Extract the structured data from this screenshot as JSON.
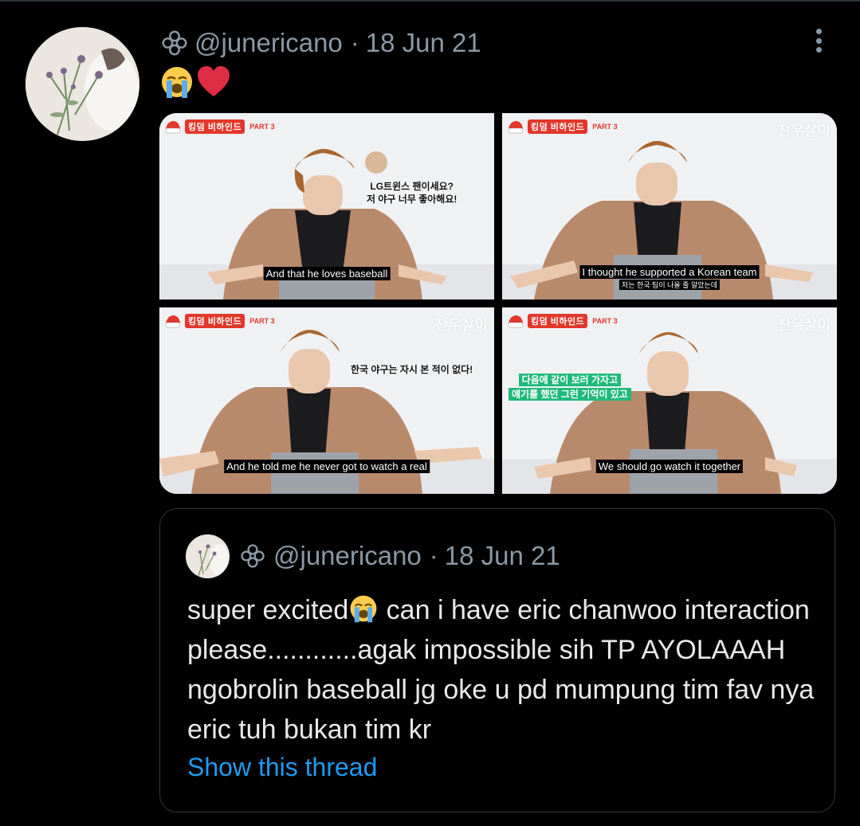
{
  "tweet": {
    "handle": "@junericano",
    "separator": "·",
    "date": "18 Jun 21",
    "emojis": [
      "loudly-crying-face",
      "red-heart"
    ],
    "media": {
      "show_tag": "킹덤 비하인드",
      "show_part": "PART 3",
      "channel": "찬우살이",
      "tiles": [
        {
          "subtitle_en": "And that he loves baseball",
          "subtitle_kr": "",
          "overlay_kr": [
            "LG트윈스 팬이세요?",
            "저 야구 너무 좋아해요!"
          ]
        },
        {
          "subtitle_en": "I thought he supported a Korean team",
          "subtitle_kr": "저는 한국 팀이 나올 줄 알았는데",
          "overlay_kr": []
        },
        {
          "subtitle_en": "And he told me he never got to watch a real",
          "subtitle_kr": "",
          "overlay_kr": [
            "한국 야구는 자시 본 적이 없다!"
          ]
        },
        {
          "subtitle_en": "We should go watch it together",
          "subtitle_kr": "",
          "overlay_kr": [
            "다음에 같이 보러 가자고",
            "얘기를 했던 그런 기억이 있고"
          ]
        }
      ]
    }
  },
  "quoted": {
    "handle": "@junericano",
    "separator": "·",
    "date": "18 Jun 21",
    "text_before_emoji": "super excited",
    "text_after_emoji": " can i have eric chanwoo interaction please............agak impossible sih TP AYOLAAAH ngobrolin baseball jg oke u pd mumpung tim fav nya eric tuh bukan tim kr",
    "show_thread": "Show this thread"
  },
  "colors": {
    "background": "#000000",
    "text": "#e7e9ea",
    "secondary": "#8b98a5",
    "link": "#1d9bf0",
    "border": "#333639"
  }
}
